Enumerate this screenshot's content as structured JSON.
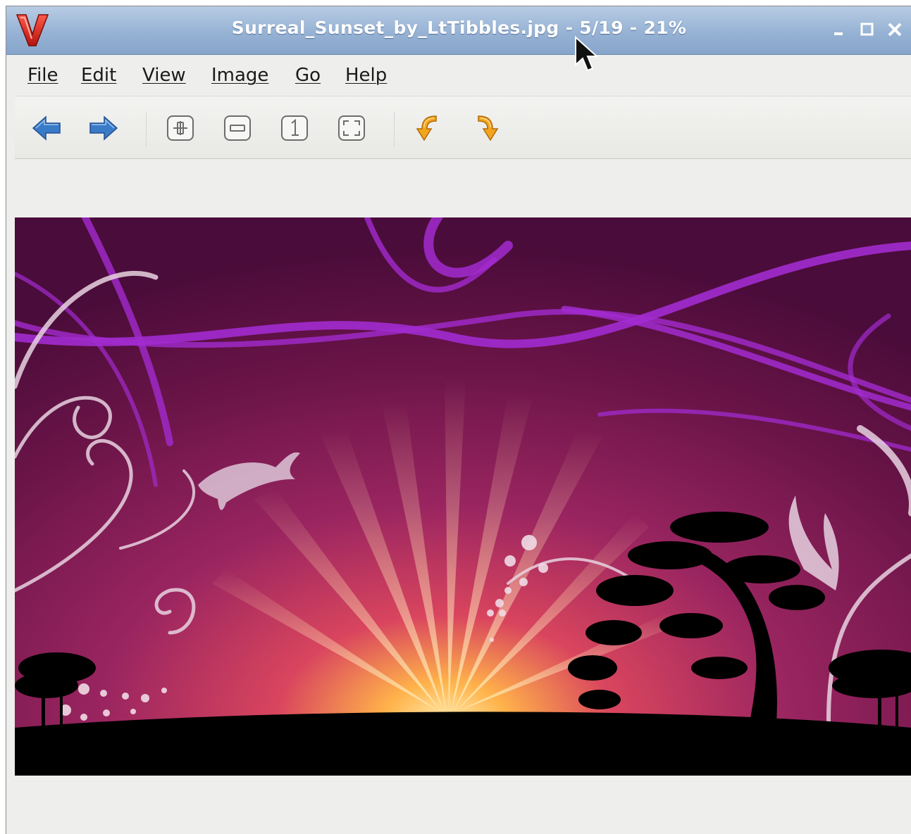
{
  "window": {
    "title": "Surreal_Sunset_by_LtTibbles.jpg - 5/19 - 21%",
    "app_icon": "viewnior-logo-icon",
    "controls": [
      "minimize-icon",
      "maximize-icon",
      "close-icon"
    ]
  },
  "menubar": {
    "items": [
      {
        "label": "File"
      },
      {
        "label": "Edit"
      },
      {
        "label": "View"
      },
      {
        "label": "Image"
      },
      {
        "label": "Go"
      },
      {
        "label": "Help"
      }
    ]
  },
  "toolbar": {
    "buttons": [
      {
        "icon": "arrow-left-icon"
      },
      {
        "icon": "arrow-right-icon"
      },
      {
        "icon": "zoom-in-icon"
      },
      {
        "icon": "zoom-out-icon"
      },
      {
        "icon": "zoom-normal-icon"
      },
      {
        "icon": "zoom-fit-icon"
      },
      {
        "icon": "rotate-left-icon"
      },
      {
        "icon": "rotate-right-icon"
      }
    ]
  },
  "image": {
    "subject": "surreal sunset wallpaper",
    "colors": {
      "sky": "#5a1040",
      "glow": "#ff9a3c",
      "ribbons": "#a22bd0",
      "ground": "#000000"
    }
  },
  "colors": {
    "titlebar": "#96b2d4",
    "chrome": "#eeeeec",
    "arrow_blue": "#3a7bc8",
    "rotate_orange": "#f0a020"
  }
}
